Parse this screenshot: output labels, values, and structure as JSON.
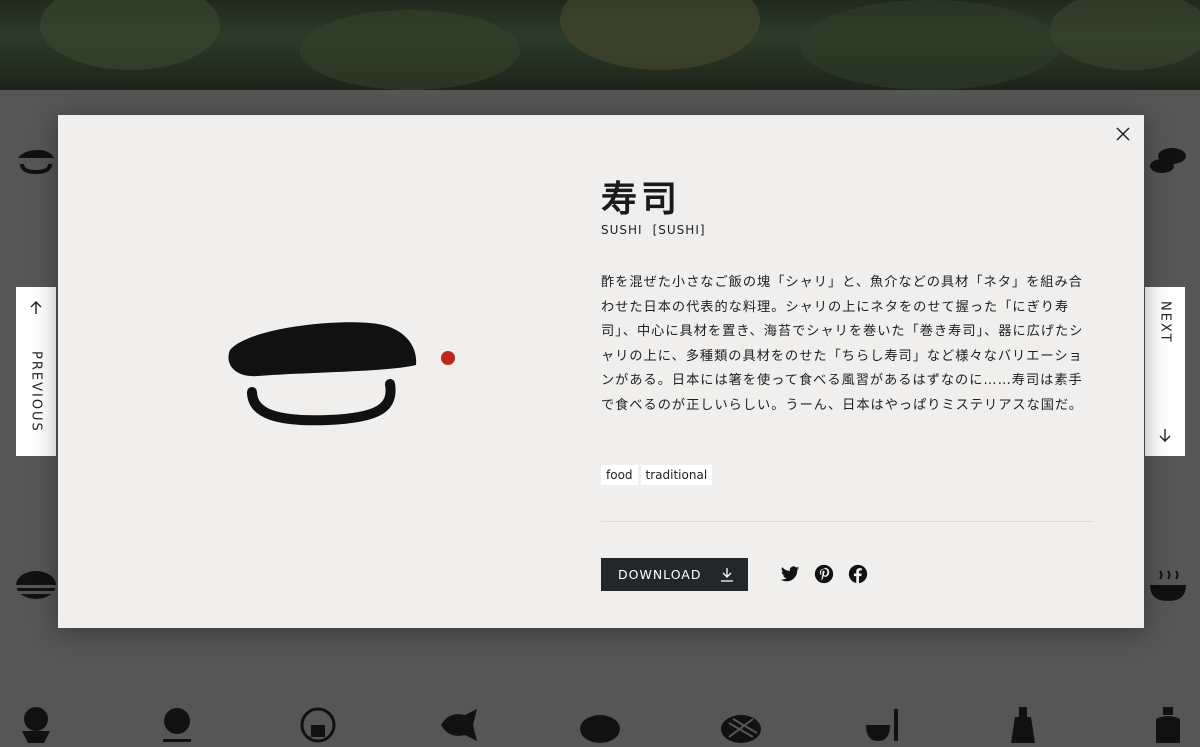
{
  "item": {
    "title": "寿司",
    "romaji": "SUSHI",
    "romaji_alt": "[SUSHI]",
    "description": "酢を混ぜた小さなご飯の塊「シャリ」と、魚介などの具材「ネタ」を組み合わせた日本の代表的な料理。シャリの上にネタをのせて握った「にぎり寿司」、中心に具材を置き、海苔でシャリを巻いた「巻き寿司」、器に広げたシャリの上に、多種類の具材をのせた「ちらし寿司」など様々なバリエーションがある。日本には箸を使って食べる風習があるはずなのに……寿司は素手で食べるのが正しいらしい。うーん、日本はやっぱりミステリアスな国だ。",
    "tags": [
      "food",
      "traditional"
    ],
    "illustration": "nigiri-sushi-icon"
  },
  "actions": {
    "download_label": "DOWNLOAD",
    "share": [
      "twitter-icon",
      "pinterest-icon",
      "facebook-icon"
    ]
  },
  "nav": {
    "previous_label": "PREVIOUS",
    "next_label": "NEXT"
  },
  "colors": {
    "modal_bg": "#f0efed",
    "accent_red": "#c0261a",
    "ink": "#1a1a1a",
    "button_bg": "#23272a",
    "overlay_bg": "#565656"
  },
  "background_icons": [
    "sushi-icon",
    "mochi-icon",
    "onigiri-icon",
    "ramen-bowl-icon",
    "shaved-ice-icon",
    "flower-wagashi-icon",
    "rice-ball-icon",
    "taiyaki-icon",
    "manju-icon",
    "melon-pan-icon",
    "matcha-icon",
    "sake-bottle-icon",
    "jar-icon"
  ]
}
